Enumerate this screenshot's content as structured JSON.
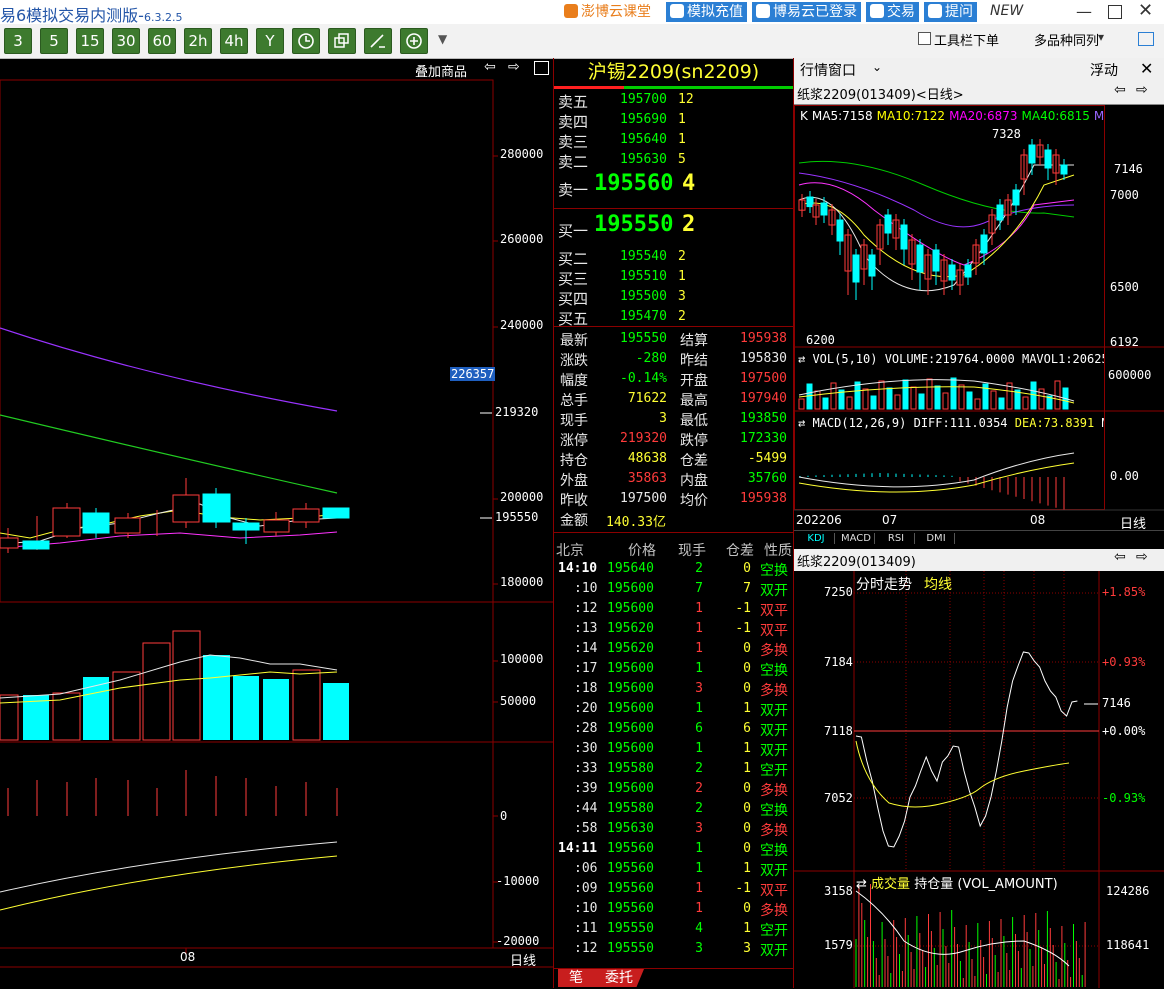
{
  "app": {
    "title": "易6模拟交易内测版-",
    "version": "6.3.2.5"
  },
  "titlebar_links": [
    {
      "label": "澎博云课堂",
      "color": "#e97e1c",
      "icon": "video-icon"
    },
    {
      "label": "模拟充值",
      "color": "#2b7fd4",
      "icon": "dollar-icon"
    },
    {
      "label": "博易云已登录",
      "color": "#2b7fd4",
      "icon": "user-icon"
    },
    {
      "label": "交易",
      "color": "#2b7fd4",
      "icon": "lightning-icon"
    },
    {
      "label": "提问",
      "color": "#2b7fd4",
      "icon": "chat-icon"
    }
  ],
  "titlebar_new": "NEW",
  "period_buttons": [
    "3",
    "5",
    "15",
    "30",
    "60",
    "2h",
    "4h",
    "Y"
  ],
  "toolbar_right": {
    "checkbox_label": "工具栏下单",
    "multi_label": "多品种同列"
  },
  "left_chart": {
    "overlay_label": "叠加商品",
    "price_ticks": [
      "280000",
      "260000",
      "240000",
      "200000",
      "180000"
    ],
    "high_tag": "226357",
    "limit_label": "219320",
    "last_label": "195550",
    "vol_ticks": [
      "100000",
      "50000"
    ],
    "macd_ticks": [
      "0",
      "-10000",
      "-20000"
    ],
    "date_label": "08",
    "period_label": "日线"
  },
  "quote": {
    "title": "沪锡2209(sn2209)",
    "asks": [
      {
        "label": "卖五",
        "price": "195700",
        "vol": "12"
      },
      {
        "label": "卖四",
        "price": "195690",
        "vol": "1"
      },
      {
        "label": "卖三",
        "price": "195640",
        "vol": "1"
      },
      {
        "label": "卖二",
        "price": "195630",
        "vol": "5"
      }
    ],
    "ask1": {
      "label": "卖一",
      "price": "195560",
      "vol": "4"
    },
    "bid1": {
      "label": "买一",
      "price": "195550",
      "vol": "2"
    },
    "bids": [
      {
        "label": "买二",
        "price": "195540",
        "vol": "2"
      },
      {
        "label": "买三",
        "price": "195510",
        "vol": "1"
      },
      {
        "label": "买四",
        "price": "195500",
        "vol": "3"
      },
      {
        "label": "买五",
        "price": "195470",
        "vol": "2"
      }
    ],
    "stats": [
      {
        "l1": "最新",
        "v1": "195550",
        "c1": "grn",
        "l2": "结算",
        "v2": "195938",
        "c2": "red"
      },
      {
        "l1": "涨跌",
        "v1": "-280",
        "c1": "grn",
        "l2": "昨结",
        "v2": "195830",
        "c2": "wht"
      },
      {
        "l1": "幅度",
        "v1": "-0.14%",
        "c1": "grn",
        "l2": "开盘",
        "v2": "197500",
        "c2": "red"
      },
      {
        "l1": "总手",
        "v1": "71622",
        "c1": "yel",
        "l2": "最高",
        "v2": "197940",
        "c2": "red"
      },
      {
        "l1": "现手",
        "v1": "3",
        "c1": "yel",
        "l2": "最低",
        "v2": "193850",
        "c2": "grn"
      },
      {
        "l1": "涨停",
        "v1": "219320",
        "c1": "red",
        "l2": "跌停",
        "v2": "172330",
        "c2": "grn"
      },
      {
        "l1": "持仓",
        "v1": "48638",
        "c1": "yel",
        "l2": "仓差",
        "v2": "-5499",
        "c2": "yel"
      },
      {
        "l1": "外盘",
        "v1": "35863",
        "c1": "red",
        "l2": "内盘",
        "v2": "35760",
        "c2": "grn"
      },
      {
        "l1": "昨收",
        "v1": "197500",
        "c1": "wht",
        "l2": "均价",
        "v2": "195938",
        "c2": "red"
      }
    ],
    "amount_label": "金额",
    "amount_value": "140.33亿",
    "ticks_header": [
      "北京",
      "价格",
      "现手",
      "仓差",
      "性质"
    ],
    "ticks": [
      {
        "t": "14:10",
        "p": "195640",
        "v": "2",
        "d": "0",
        "n": "空换",
        "nc": "grn"
      },
      {
        "t": ":10",
        "p": "195600",
        "v": "7",
        "d": "7",
        "n": "双开",
        "nc": "grn"
      },
      {
        "t": ":12",
        "p": "195600",
        "v": "1",
        "d": "-1",
        "n": "双平",
        "nc": "red"
      },
      {
        "t": ":13",
        "p": "195620",
        "v": "1",
        "d": "-1",
        "n": "双平",
        "nc": "red"
      },
      {
        "t": ":14",
        "p": "195620",
        "v": "1",
        "d": "0",
        "n": "多换",
        "nc": "red"
      },
      {
        "t": ":17",
        "p": "195600",
        "v": "1",
        "d": "0",
        "n": "空换",
        "nc": "grn"
      },
      {
        "t": ":18",
        "p": "195600",
        "v": "3",
        "d": "0",
        "n": "多换",
        "nc": "red"
      },
      {
        "t": ":20",
        "p": "195600",
        "v": "1",
        "d": "1",
        "n": "双开",
        "nc": "grn"
      },
      {
        "t": ":28",
        "p": "195600",
        "v": "6",
        "d": "6",
        "n": "双开",
        "nc": "grn"
      },
      {
        "t": ":30",
        "p": "195600",
        "v": "1",
        "d": "1",
        "n": "双开",
        "nc": "grn"
      },
      {
        "t": ":33",
        "p": "195580",
        "v": "2",
        "d": "1",
        "n": "空开",
        "nc": "grn"
      },
      {
        "t": ":39",
        "p": "195600",
        "v": "2",
        "d": "0",
        "n": "多换",
        "nc": "red"
      },
      {
        "t": ":44",
        "p": "195580",
        "v": "2",
        "d": "0",
        "n": "空换",
        "nc": "grn"
      },
      {
        "t": ":58",
        "p": "195630",
        "v": "3",
        "d": "0",
        "n": "多换",
        "nc": "red"
      },
      {
        "t": "14:11",
        "p": "195560",
        "v": "1",
        "d": "0",
        "n": "空换",
        "nc": "grn"
      },
      {
        "t": ":06",
        "p": "195560",
        "v": "1",
        "d": "1",
        "n": "双开",
        "nc": "grn"
      },
      {
        "t": ":09",
        "p": "195560",
        "v": "1",
        "d": "-1",
        "n": "双平",
        "nc": "red"
      },
      {
        "t": ":10",
        "p": "195560",
        "v": "1",
        "d": "0",
        "n": "多换",
        "nc": "red"
      },
      {
        "t": ":11",
        "p": "195550",
        "v": "4",
        "d": "1",
        "n": "空开",
        "nc": "grn"
      },
      {
        "t": ":12",
        "p": "195550",
        "v": "3",
        "d": "3",
        "n": "双开",
        "nc": "grn"
      }
    ],
    "bottom_tabs": [
      "笔",
      "委托"
    ]
  },
  "right_top": {
    "header": "行情窗口",
    "float_label": "浮动",
    "kline_title": "纸浆2209(013409)<日线>",
    "ma_items": [
      {
        "text": "K",
        "color": "#ffffff"
      },
      {
        "text": "MA5:7158",
        "color": "#ffffff"
      },
      {
        "text": "MA10:7122",
        "color": "#ffff00"
      },
      {
        "text": "MA20:6873",
        "color": "#ff00ff"
      },
      {
        "text": "MA40:6815",
        "color": "#00ff00"
      },
      {
        "text": "MA6",
        "color": "#9966ff"
      }
    ],
    "price_ticks": [
      "7146",
      "7000",
      "6500",
      "6192"
    ],
    "high_mark": "7328",
    "low_mark": "6200",
    "vol_title": "VOL(5,10) VOLUME:219764.0000 MAVOL1:20625",
    "vol_tick": "600000",
    "macd_title": "MACD(12,26,9) DIFF:111.0354",
    "macd_dea": "DEA:73.8391",
    "macd_m": "M",
    "macd_tick": "0.00",
    "dates": [
      "202206",
      "07",
      "08"
    ],
    "period_label": "日线",
    "tabs": [
      "KDJ",
      "MACD",
      "RSI",
      "DMI"
    ]
  },
  "right_bottom": {
    "title": "纸浆2209(013409)",
    "subtitle": "分时走势",
    "avg_label": "均线",
    "price_ticks": [
      "7250",
      "7184",
      "7118",
      "7052"
    ],
    "pct_ticks": [
      "+1.85%",
      "+0.93%",
      "+0.00%",
      "-0.93%"
    ],
    "last_label": "7146",
    "vol_title_1": "成交量",
    "vol_title_2": "持仓量",
    "vol_title_3": "(VOL_AMOUNT)",
    "vol_ticks": [
      "3158",
      "1579"
    ],
    "oi_ticks": [
      "124286",
      "118641"
    ]
  }
}
